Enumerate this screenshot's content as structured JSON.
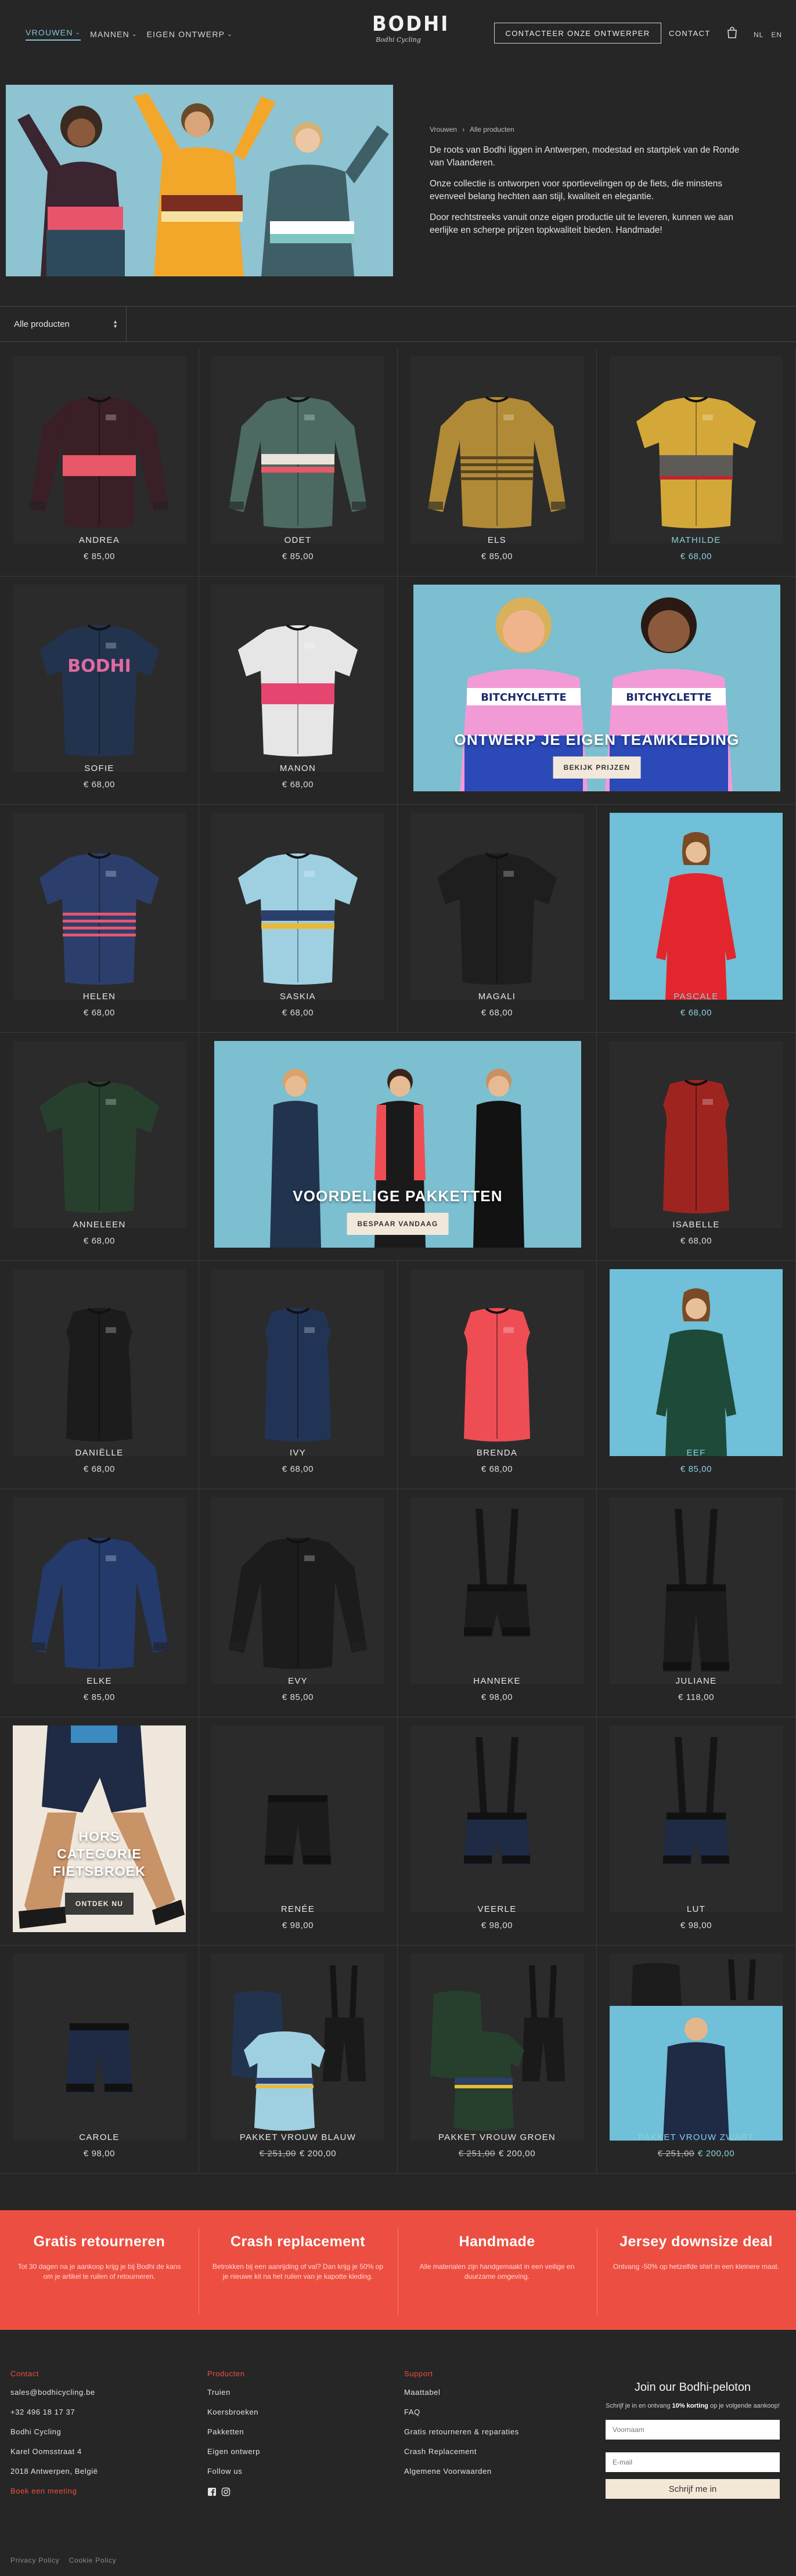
{
  "header": {
    "nav": [
      {
        "label": "VROUWEN",
        "active": true
      },
      {
        "label": "MANNEN",
        "active": false
      },
      {
        "label": "EIGEN ONTWERP",
        "active": false
      }
    ],
    "logo_text": "BODHI",
    "logo_sub": "Bodhi Cycling",
    "contact_designer_button": "CONTACTEER ONZE ONTWERPER",
    "contact_link": "CONTACT",
    "lang_nl": "NL",
    "lang_en": "EN",
    "bag_icon": "shopping-bag-icon"
  },
  "intro": {
    "breadcrumb": [
      "Vrouwen",
      "Alle producten"
    ],
    "breadcrumb_sep": "›",
    "paragraphs": [
      "De roots van Bodhi liggen in Antwerpen, modestad en startplek van de Ronde van Vlaanderen.",
      "Onze collectie is ontworpen voor sportievelingen op de fiets, die minstens evenveel belang hechten aan stijl, kwaliteit en elegantie.",
      "Door rechtstreeks vanuit onze eigen productie uit te leveren, kunnen we aan eerlijke en scherpe prijzen topkwaliteit bieden. Handmade!"
    ]
  },
  "filter": {
    "selected": "Alle producten"
  },
  "products": [
    {
      "name": "ANDREA",
      "price": "€ 85,00"
    },
    {
      "name": "ODET",
      "price": "€ 85,00"
    },
    {
      "name": "ELS",
      "price": "€ 85,00"
    },
    {
      "name": "MATHILDE",
      "price": "€ 68,00"
    },
    {
      "name": "SOFIE",
      "price": "€ 68,00"
    },
    {
      "name": "MANON",
      "price": "€ 68,00"
    },
    {
      "name": "HELEN",
      "price": "€ 68,00"
    },
    {
      "name": "SASKIA",
      "price": "€ 68,00"
    },
    {
      "name": "MAGALI",
      "price": "€ 68,00"
    },
    {
      "name": "PASCALE",
      "price": "€ 68,00"
    },
    {
      "name": "ANNELEEN",
      "price": "€ 68,00"
    },
    {
      "name": "ISABELLE",
      "price": "€ 68,00"
    },
    {
      "name": "DANIËLLE",
      "price": "€ 68,00"
    },
    {
      "name": "IVY",
      "price": "€ 68,00"
    },
    {
      "name": "BRENDA",
      "price": "€ 68,00"
    },
    {
      "name": "EEF",
      "price": "€ 85,00"
    },
    {
      "name": "ELKE",
      "price": "€ 85,00"
    },
    {
      "name": "EVY",
      "price": "€ 85,00"
    },
    {
      "name": "HANNEKE",
      "price": "€ 98,00"
    },
    {
      "name": "JULIANE",
      "price": "€ 118,00"
    },
    {
      "name": "RENÉE",
      "price": "€ 98,00"
    },
    {
      "name": "VEERLE",
      "price": "€ 98,00"
    },
    {
      "name": "LUT",
      "price": "€ 98,00"
    },
    {
      "name": "CAROLE",
      "price": "€ 98,00"
    },
    {
      "name": "PAKKET VROUW BLAUW",
      "price_old": "€ 251,00",
      "price": "€ 200,00"
    },
    {
      "name": "PAKKET VROUW GROEN",
      "price_old": "€ 251,00",
      "price": "€ 200,00"
    },
    {
      "name": "PAKKET VROUW ZWART",
      "price_old": "€ 251,00",
      "price": "€ 200,00"
    }
  ],
  "banners": {
    "team": {
      "title": "ONTWERP JE EIGEN TEAMKLEDING",
      "button": "BEKIJK PRIJZEN",
      "jersey_text": "BITCHYCLETTE"
    },
    "packages": {
      "title": "VOORDELIGE PAKKETTEN",
      "button": "BESPAAR VANDAAG"
    },
    "shorts": {
      "title_line1": "HORS",
      "title_line2": "CATEGORIE",
      "title_line3": "FIETSBROEK",
      "button": "ONTDEK NU"
    }
  },
  "usps": [
    {
      "title": "Gratis retourneren",
      "text": "Tot 30 dagen na je aankoop krijg je bij Bodhi de kans om je artikel te ruilen of retourneren."
    },
    {
      "title": "Crash replacement",
      "text": "Betrokken bij een aanrijding of val? Dan krijg je 50% op je nieuwe kit na het ruilen van je kapotte kleding."
    },
    {
      "title": "Handmade",
      "text": "Alle materialen zijn handgemaakt in een veilige en duurzame omgeving."
    },
    {
      "title": "Jersey downsize deal",
      "text": "Ontvang -50% op hetzelfde shirt in een kleinere maat."
    }
  ],
  "footer": {
    "contact": {
      "heading": "Contact",
      "items": [
        "sales@bodhicycling.be",
        "+32 496 18 17 37",
        "Bodhi Cycling",
        "Karel Oomsstraat 4",
        "2018 Antwerpen, België"
      ],
      "cta": "Boek een meeting"
    },
    "products": {
      "heading": "Producten",
      "items": [
        "Truien",
        "Koersbroeken",
        "Pakketten",
        "Eigen ontwerp",
        "Follow us"
      ]
    },
    "support": {
      "heading": "Support",
      "items": [
        "Maattabel",
        "FAQ",
        "Gratis retourneren & reparaties",
        "Crash Replacement",
        "Algemene Voorwaarden"
      ]
    },
    "newsletter": {
      "title": "Join our Bodhi-peloton",
      "text_pre": "Schrijf je in en ontvang ",
      "text_bold": "10% korting",
      "text_post": " op je volgende aankoop!",
      "name_placeholder": "Voornaam",
      "email_placeholder": "E-mail",
      "button": "Schrijf me in"
    },
    "legal": [
      "Privacy Policy",
      "Cookie Policy"
    ]
  },
  "colors": {
    "bg": "#262626",
    "accent": "#7fc8d6",
    "brand_red": "#ec4f41",
    "button_cream": "#f2e8da"
  }
}
